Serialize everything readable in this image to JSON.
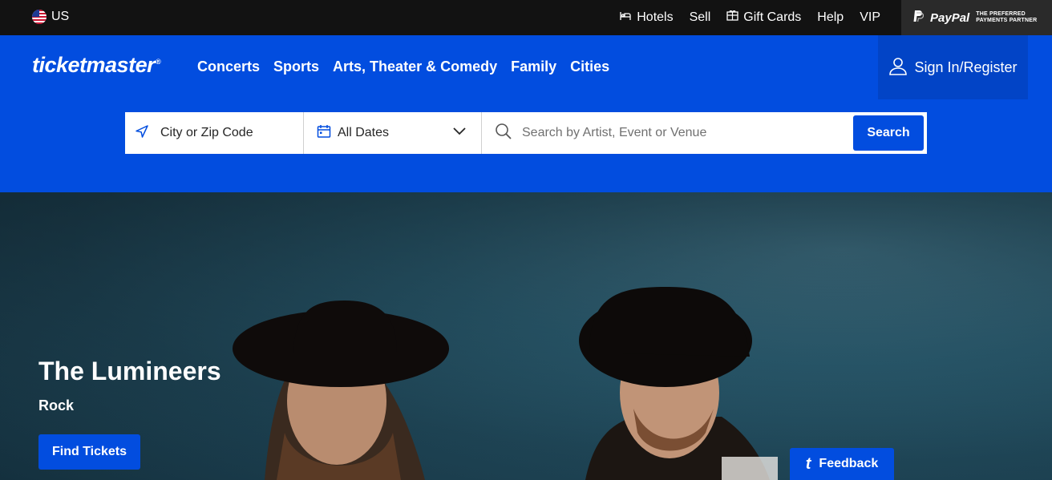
{
  "topbar": {
    "locale_label": "US",
    "links": [
      "Hotels",
      "Sell",
      "Gift Cards",
      "Help",
      "VIP"
    ],
    "paypal_brand": "PayPal",
    "paypal_tagline": "THE PREFERRED PAYMENTS PARTNER"
  },
  "header": {
    "logo_text": "ticketmaster",
    "logo_mark": "®",
    "nav": [
      "Concerts",
      "Sports",
      "Arts, Theater & Comedy",
      "Family",
      "Cities"
    ],
    "signin_label": "Sign In/Register"
  },
  "search": {
    "location_placeholder": "City or Zip Code",
    "date_value": "All Dates",
    "query_placeholder": "Search by Artist, Event or Venue",
    "button_label": "Search"
  },
  "hero": {
    "title": "The Lumineers",
    "genre": "Rock",
    "cta_label": "Find Tickets"
  },
  "feedback": {
    "icon_glyph": "t",
    "label": "Feedback"
  },
  "colors": {
    "brand_blue": "#024ddf",
    "topbar_bg": "#121212",
    "signin_bg": "#0244c6"
  },
  "icons": [
    "us-flag-icon",
    "hotel-icon",
    "gift-card-icon",
    "user-icon",
    "location-arrow-icon",
    "calendar-icon",
    "chevron-down-icon",
    "search-icon"
  ]
}
